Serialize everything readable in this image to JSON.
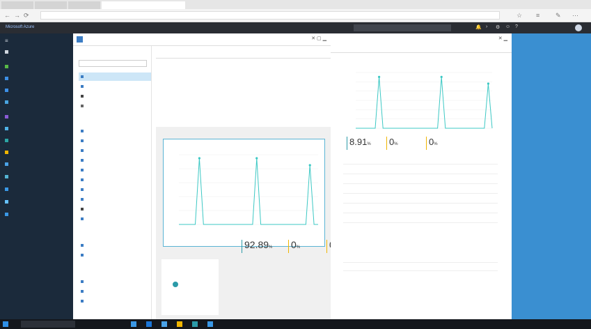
{
  "browser": {
    "tabs": [
      "",
      "",
      "",
      ""
    ],
    "url": "",
    "nav": {
      "back": "←",
      "forward": "→",
      "refresh": "⟳"
    },
    "toolbar": [
      "☆",
      "≡",
      "✎",
      "⋯"
    ]
  },
  "portal": {
    "brand": "Microsoft Azure",
    "breadcrumb": "",
    "search_placeholder": "",
    "user": ""
  },
  "sidenav": {
    "items": [
      {
        "label": "",
        "color": "#cfd6df"
      },
      {
        "label": "",
        "color": "#58b947"
      },
      {
        "label": "",
        "color": "#3c8fe6"
      },
      {
        "label": "",
        "color": "#3c8fe6"
      },
      {
        "label": "",
        "color": "#49a4e0"
      },
      {
        "label": "",
        "color": "#8a5bd6"
      },
      {
        "label": "",
        "color": "#4fb3e8"
      },
      {
        "label": "",
        "color": "#2ca5a5"
      },
      {
        "label": "",
        "color": "#f0b500"
      },
      {
        "label": "",
        "color": "#4aa3e8"
      },
      {
        "label": "",
        "color": "#54b4d4"
      },
      {
        "label": "",
        "color": "#3a98e6"
      },
      {
        "label": "",
        "color": "#66c2ff"
      },
      {
        "label": "",
        "color": "#3a98e6"
      },
      {
        "label": "",
        "color": "#cfd6df"
      }
    ]
  },
  "blade1": {
    "title": "",
    "controls": "✕  ▢  ▁",
    "menu_search": "",
    "menu": [
      {
        "label": "",
        "selected": true,
        "color": "#3c7dc4"
      },
      {
        "label": "",
        "selected": false,
        "color": "#3c7dc4"
      },
      {
        "label": "",
        "selected": false,
        "color": "#444"
      },
      {
        "label": "",
        "selected": false,
        "color": "#666"
      }
    ],
    "menu2_header": "",
    "menu2": [
      "",
      "",
      "",
      "",
      "",
      "",
      "",
      "",
      "",
      ""
    ],
    "menu3_header": "",
    "menu3": [
      "",
      ""
    ],
    "menu4_header": "",
    "menu4": [
      "",
      "",
      ""
    ],
    "cmd": [
      "",
      "",
      "",
      "",
      "",
      "",
      ""
    ],
    "essentials": {
      "header": "",
      "left": [
        {
          "label": "",
          "value": ""
        },
        {
          "label": "",
          "value": ""
        },
        {
          "label": "",
          "value": ""
        },
        {
          "label": "",
          "value": ""
        },
        {
          "label": "",
          "value": ""
        },
        {
          "label": "",
          "value": ""
        },
        {
          "label": "",
          "value": ""
        },
        {
          "label": "",
          "value": ""
        },
        {
          "label": "",
          "value": ""
        }
      ],
      "right": [
        {
          "label": "",
          "value": ""
        },
        {
          "label": "",
          "value": ""
        },
        {
          "label": "",
          "value": ""
        },
        {
          "label": "",
          "value": ""
        },
        {
          "label": "",
          "value": ""
        },
        {
          "label": "",
          "value": ""
        },
        {
          "label": "",
          "value": ""
        },
        {
          "label": "",
          "value": ""
        },
        {
          "label": "",
          "value": ""
        }
      ]
    },
    "monitoring_header": "",
    "chart_title": "",
    "ops_header": "",
    "card": {
      "title": "",
      "description": ""
    },
    "stats": [
      {
        "label": "",
        "value": "92.89",
        "unit": "%",
        "color": "#2b9aa8"
      },
      {
        "label": "",
        "value": "0",
        "unit": "%",
        "color": "#f0b500"
      },
      {
        "label": "",
        "value": "0",
        "unit": "%",
        "color": "#f0b500"
      }
    ]
  },
  "blade2": {
    "title": "",
    "subtitle": "",
    "controls": "✕  ▁",
    "toolbar": [
      "",
      "",
      ""
    ],
    "chart_title": "",
    "stats": [
      {
        "label": "",
        "value": "8.91",
        "unit": "%",
        "color": "#2b9aa8"
      },
      {
        "label": "",
        "value": "0",
        "unit": "%",
        "color": "#f0b500"
      },
      {
        "label": "",
        "value": "0",
        "unit": "%",
        "color": "#f0b500"
      }
    ],
    "table": {
      "headers": [
        "",
        "",
        "",
        "",
        ""
      ],
      "rows": [
        [
          "",
          "",
          "",
          "",
          ""
        ],
        [
          "",
          "",
          "",
          "",
          ""
        ],
        [
          "",
          "",
          "",
          "",
          ""
        ],
        [
          "",
          "",
          "",
          "",
          ""
        ],
        [
          "",
          "",
          "",
          "",
          ""
        ],
        [
          "",
          "",
          "",
          "",
          ""
        ]
      ]
    },
    "events_header": "",
    "events_table": {
      "headers": [
        "",
        "",
        ""
      ],
      "rows": [
        [
          "",
          "",
          ""
        ]
      ]
    }
  },
  "taskbar": {
    "search": "",
    "apps": [
      "#3a98e6",
      "#1b76d8",
      "#4aa3e8",
      "#f0b500",
      "#2b9aa8",
      "#3a98e6"
    ],
    "clock": ""
  },
  "chart_data": [
    {
      "type": "line",
      "title": "",
      "xlabel": "",
      "ylabel": "",
      "ylim": [
        0,
        100
      ],
      "series": [
        {
          "values": [
            0,
            0,
            0,
            0,
            0,
            95,
            0,
            0,
            0,
            0,
            0,
            0,
            0,
            0,
            0,
            0,
            0,
            0,
            0,
            95,
            0,
            0,
            0,
            0,
            0,
            0,
            0,
            0,
            0,
            0,
            0,
            0,
            85,
            0,
            0
          ]
        }
      ],
      "x_ticks": [
        "",
        "",
        "",
        "",
        ""
      ],
      "y_ticks": [
        "",
        "",
        "",
        "",
        "",
        ""
      ]
    },
    {
      "type": "line",
      "title": "",
      "xlabel": "",
      "ylabel": "",
      "ylim": [
        0,
        100
      ],
      "series": [
        {
          "values": [
            0,
            0,
            0,
            0,
            0,
            0,
            92,
            0,
            0,
            0,
            0,
            0,
            0,
            0,
            0,
            0,
            0,
            0,
            0,
            0,
            0,
            0,
            92,
            0,
            0,
            0,
            0,
            0,
            0,
            0,
            0,
            0,
            0,
            0,
            80,
            0
          ]
        }
      ],
      "x_ticks": [
        "",
        "",
        "",
        "",
        ""
      ],
      "y_ticks": [
        "",
        "",
        "",
        "",
        "",
        "",
        ""
      ]
    }
  ]
}
